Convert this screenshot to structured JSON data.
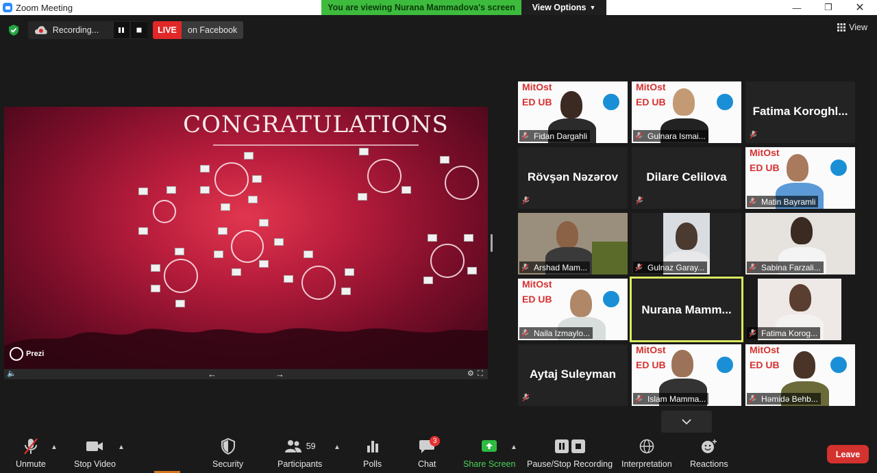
{
  "window": {
    "title": "Zoom Meeting"
  },
  "share_banner": {
    "viewing_text": "You are viewing Nurana Mammadova's screen",
    "view_options_label": "View Options"
  },
  "status": {
    "recording_label": "Recording...",
    "live_label": "LIVE",
    "live_platform": "on Facebook",
    "view_label": "View"
  },
  "shared_screen": {
    "heading": "CONGRATULATIONS",
    "brand": "Prezi"
  },
  "gallery": {
    "tiles": [
      {
        "name": "Fidan Dargahli",
        "type": "video"
      },
      {
        "name": "Gulnara Ismai...",
        "type": "video"
      },
      {
        "name": "Fatima Koroghl...",
        "type": "name"
      },
      {
        "name": "Rövşən Nəzərov",
        "type": "name"
      },
      {
        "name": "Dilare Celilova",
        "type": "name"
      },
      {
        "name": "Matin Bayramli",
        "type": "video"
      },
      {
        "name": "Arshad Mam...",
        "type": "video"
      },
      {
        "name": "Gulnaz Garay...",
        "type": "video"
      },
      {
        "name": "Sabina Farzali...",
        "type": "video"
      },
      {
        "name": "Naila Izmaylo...",
        "type": "video"
      },
      {
        "name": "Nurana Mamm...",
        "type": "name",
        "active": true
      },
      {
        "name": "Fatima Korog...",
        "type": "video"
      },
      {
        "name": "Aytaj Suleyman",
        "type": "name"
      },
      {
        "name": "Islam Mamma...",
        "type": "video"
      },
      {
        "name": "Həmidə Behb...",
        "type": "video"
      }
    ]
  },
  "toolbar": {
    "unmute": "Unmute",
    "stop_video": "Stop Video",
    "security": "Security",
    "participants": "Participants",
    "participants_count": "59",
    "polls": "Polls",
    "chat": "Chat",
    "chat_badge": "3",
    "share_screen": "Share Screen",
    "pause_stop_recording": "Pause/Stop Recording",
    "interpretation": "Interpretation",
    "reactions": "Reactions",
    "leave": "Leave"
  },
  "colors": {
    "share_green": "#3dbb3d",
    "live_red": "#e02828",
    "active_speaker": "#dbe85f",
    "leave_red": "#d4322f",
    "share_screen_green": "#4dd05a"
  }
}
